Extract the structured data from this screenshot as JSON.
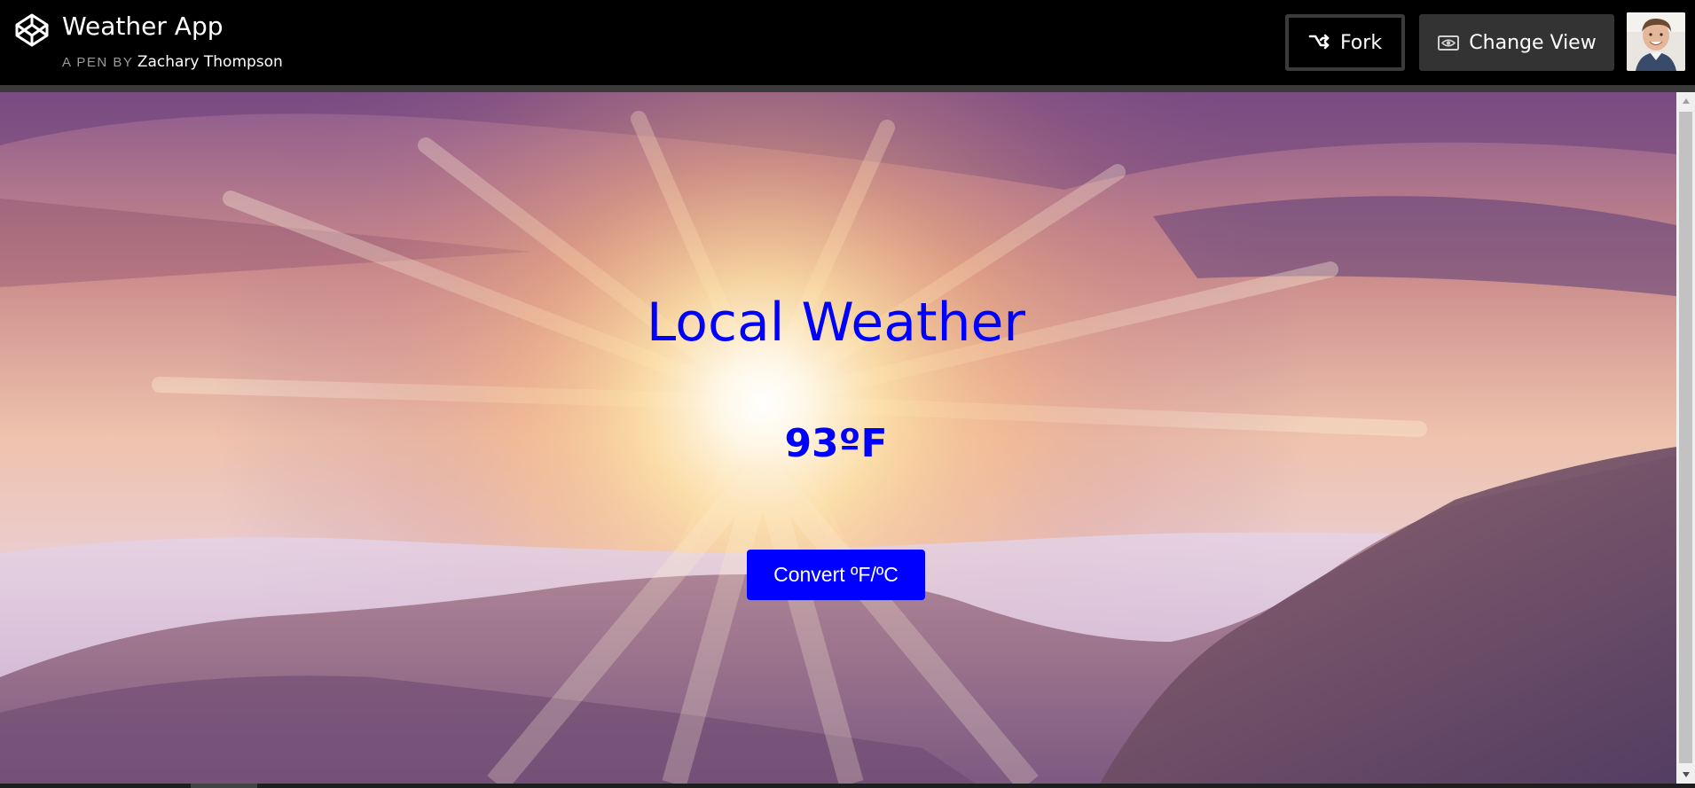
{
  "header": {
    "title": "Weather App",
    "pen_by_prefix": "A PEN BY",
    "author": "Zachary Thompson",
    "fork_label": "Fork",
    "change_view_label": "Change View",
    "logo_icon": "codepen-logo-icon",
    "fork_icon": "fork-icon",
    "change_view_icon": "eye-icon"
  },
  "preview": {
    "heading": "Local Weather",
    "temperature": "93ºF",
    "convert_button": "Convert ºF/ºC"
  },
  "colors": {
    "accent_blue": "#0000ff",
    "header_bg": "#000000",
    "change_view_bg": "#333333",
    "fork_border": "#3b3b3b"
  }
}
